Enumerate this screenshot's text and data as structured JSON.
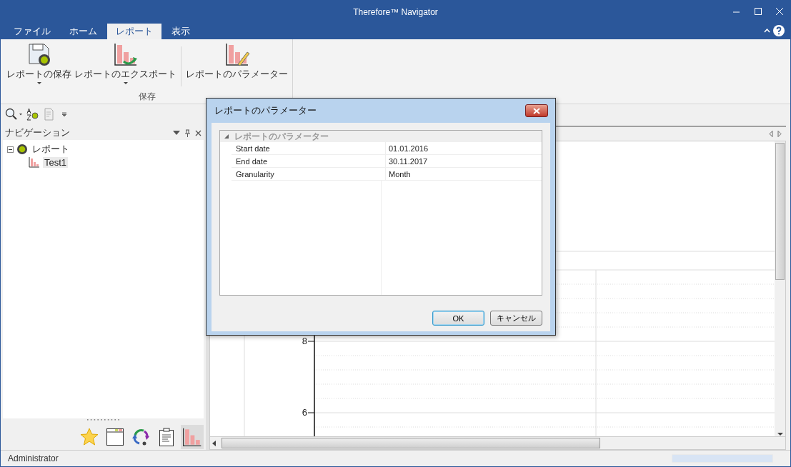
{
  "window": {
    "title": "Therefore™ Navigator"
  },
  "ribbon_tabs": [
    {
      "label": "ファイル",
      "selected": false
    },
    {
      "label": "ホーム",
      "selected": false
    },
    {
      "label": "レポート",
      "selected": true
    },
    {
      "label": "表示",
      "selected": false
    }
  ],
  "ribbon": {
    "buttons": [
      {
        "label": "レポートの保存",
        "dropdown": true
      },
      {
        "label": "レポートのエクスポート",
        "dropdown": true
      },
      {
        "label": "レポートのパラメーター",
        "dropdown": false
      }
    ],
    "group_label": "保存"
  },
  "navigation": {
    "title": "ナビゲーション",
    "tree": [
      {
        "label": "レポート",
        "expanded": true,
        "children": [
          {
            "label": "Test1",
            "selected": true
          }
        ]
      }
    ],
    "pane_buttons": [
      {
        "selected": false
      },
      {
        "selected": false
      },
      {
        "selected": false
      },
      {
        "selected": false
      },
      {
        "selected": true
      }
    ]
  },
  "document": {
    "y_ticks": [
      "8",
      "6"
    ]
  },
  "dialog": {
    "title": "レポートのパラメーター",
    "category": {
      "label": "レポートのパラメーター",
      "expanded": true
    },
    "properties": [
      {
        "name": "Start date",
        "value": "01.01.2016"
      },
      {
        "name": "End date",
        "value": "30.11.2017"
      },
      {
        "name": "Granularity",
        "value": "Month"
      }
    ],
    "buttons": [
      {
        "label": "OK",
        "default": true
      },
      {
        "label": "キャンセル",
        "default": false
      }
    ]
  },
  "status_bar": {
    "user": "Administrator",
    "progress": {
      "level": 1
    }
  }
}
